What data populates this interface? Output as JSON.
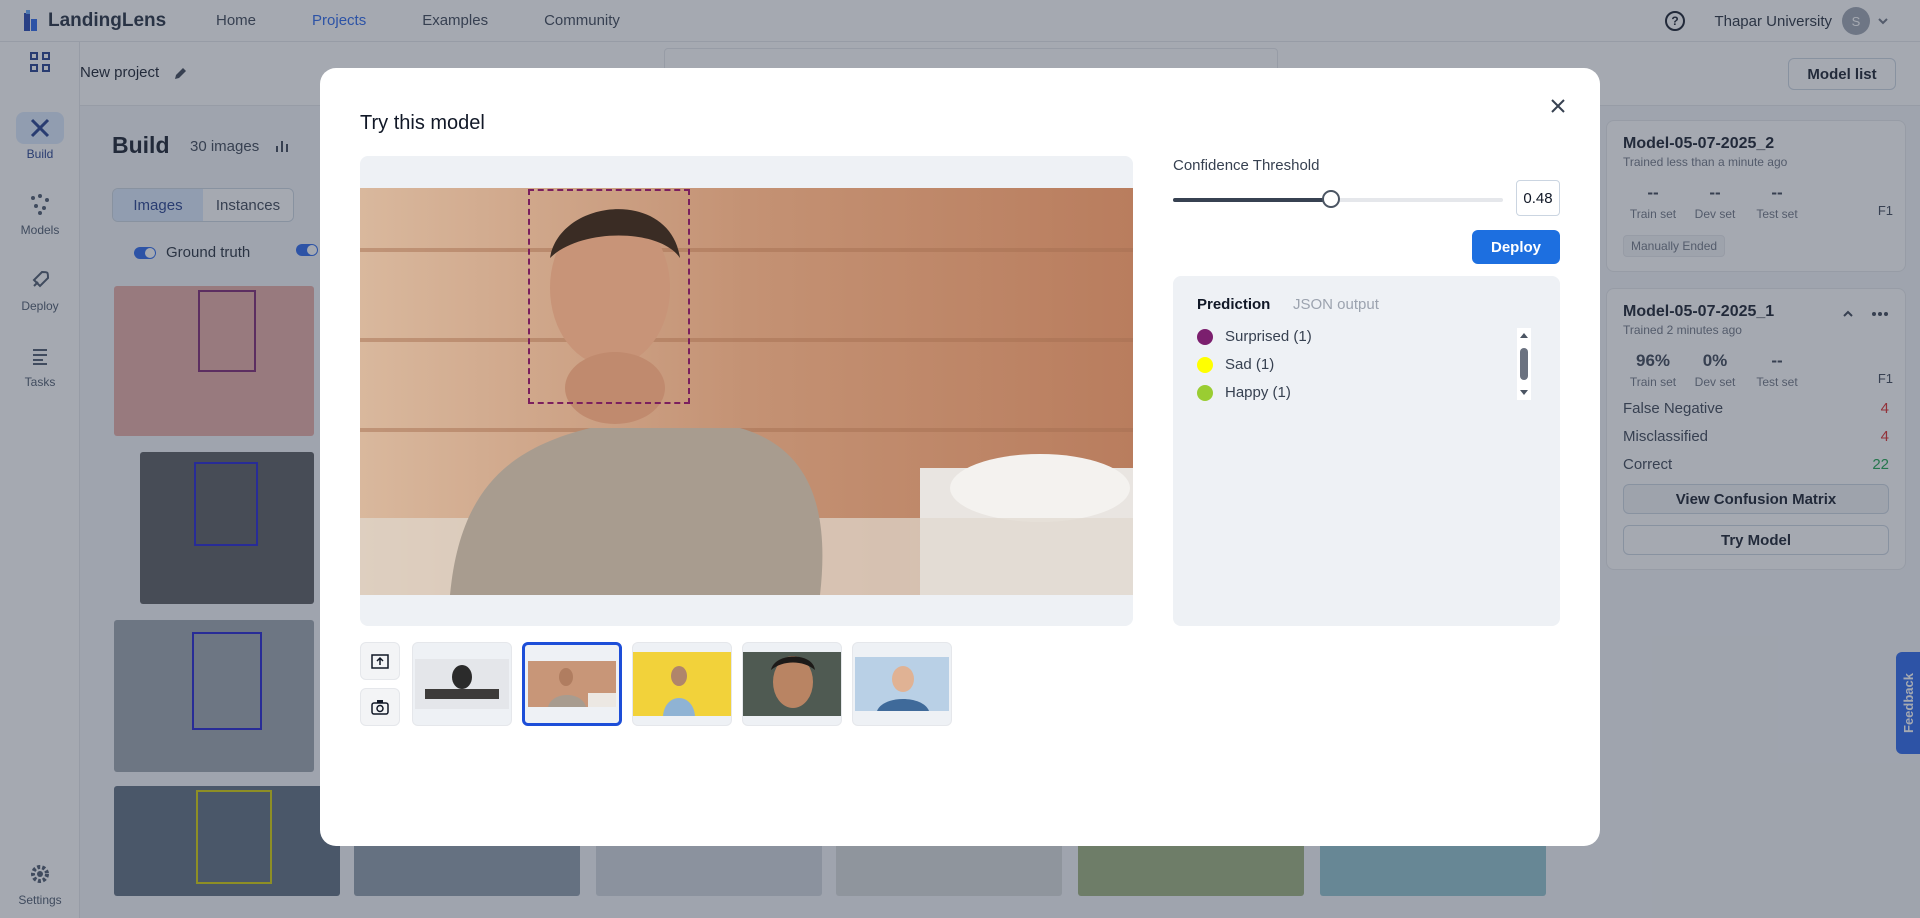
{
  "topbar": {
    "logo_text": "LandingLens",
    "nav": [
      {
        "label": "Home",
        "active": false
      },
      {
        "label": "Projects",
        "active": true
      },
      {
        "label": "Examples",
        "active": false
      },
      {
        "label": "Community",
        "active": false
      }
    ],
    "org_name": "Thapar University",
    "avatar_initial": "S",
    "icons": [
      "help-icon",
      "chevron-down-icon"
    ]
  },
  "sidebar": {
    "items": [
      {
        "label": "Build",
        "icon": "build-icon",
        "active": true
      },
      {
        "label": "Models",
        "icon": "models-icon",
        "active": false
      },
      {
        "label": "Deploy",
        "icon": "rocket-icon",
        "active": false
      },
      {
        "label": "Tasks",
        "icon": "tasks-icon",
        "active": false
      },
      {
        "label": "Settings",
        "icon": "gear-icon",
        "active": false
      }
    ]
  },
  "subheader": {
    "project_name": "New project",
    "model_list_label": "Model list"
  },
  "build": {
    "title": "Build",
    "image_count": "30 images",
    "tabs": [
      {
        "label": "Images",
        "active": true
      },
      {
        "label": "Instances",
        "active": false
      }
    ],
    "ground_truth_label": "Ground truth"
  },
  "models": [
    {
      "name": "Model-05-07-2025_2",
      "trained": "Trained less than a minute ago",
      "metrics": [
        {
          "value": "--",
          "label": "Train set"
        },
        {
          "value": "--",
          "label": "Dev set"
        },
        {
          "value": "--",
          "label": "Test set"
        }
      ],
      "f1_label": "F1",
      "status": "Manually Ended"
    },
    {
      "name": "Model-05-07-2025_1",
      "trained": "Trained 2 minutes ago",
      "metrics": [
        {
          "value": "96%",
          "label": "Train set"
        },
        {
          "value": "0%",
          "label": "Dev set"
        },
        {
          "value": "--",
          "label": "Test set"
        }
      ],
      "f1_label": "F1",
      "errors": [
        {
          "label": "False Negative",
          "count": "4",
          "color": "#dc2626"
        },
        {
          "label": "Misclassified",
          "count": "4",
          "color": "#dc2626"
        },
        {
          "label": "Correct",
          "count": "22",
          "color": "#16a34a"
        }
      ],
      "confusion_label": "View Confusion Matrix",
      "try_label": "Try Model"
    }
  ],
  "feedback_label": "Feedback",
  "modal": {
    "title": "Try this model",
    "confidence_label": "Confidence Threshold",
    "confidence_value": "0.48",
    "confidence_fraction": 0.48,
    "deploy_label": "Deploy",
    "tabs": [
      {
        "label": "Prediction",
        "active": true
      },
      {
        "label": "JSON output",
        "active": false
      }
    ],
    "predictions": [
      {
        "label": "Surprised (1)",
        "color": "#7b1f6e"
      },
      {
        "label": "Sad (1)",
        "color": "#ffff00"
      },
      {
        "label": "Happy (1)",
        "color": "#9acd32"
      }
    ],
    "thumbnails": [
      {
        "name": "thumb-man-desk",
        "selected": false
      },
      {
        "name": "thumb-man-pensive",
        "selected": true
      },
      {
        "name": "thumb-man-yellow",
        "selected": false
      },
      {
        "name": "thumb-man-closeup",
        "selected": false
      },
      {
        "name": "thumb-boy-smiling",
        "selected": false
      }
    ]
  }
}
